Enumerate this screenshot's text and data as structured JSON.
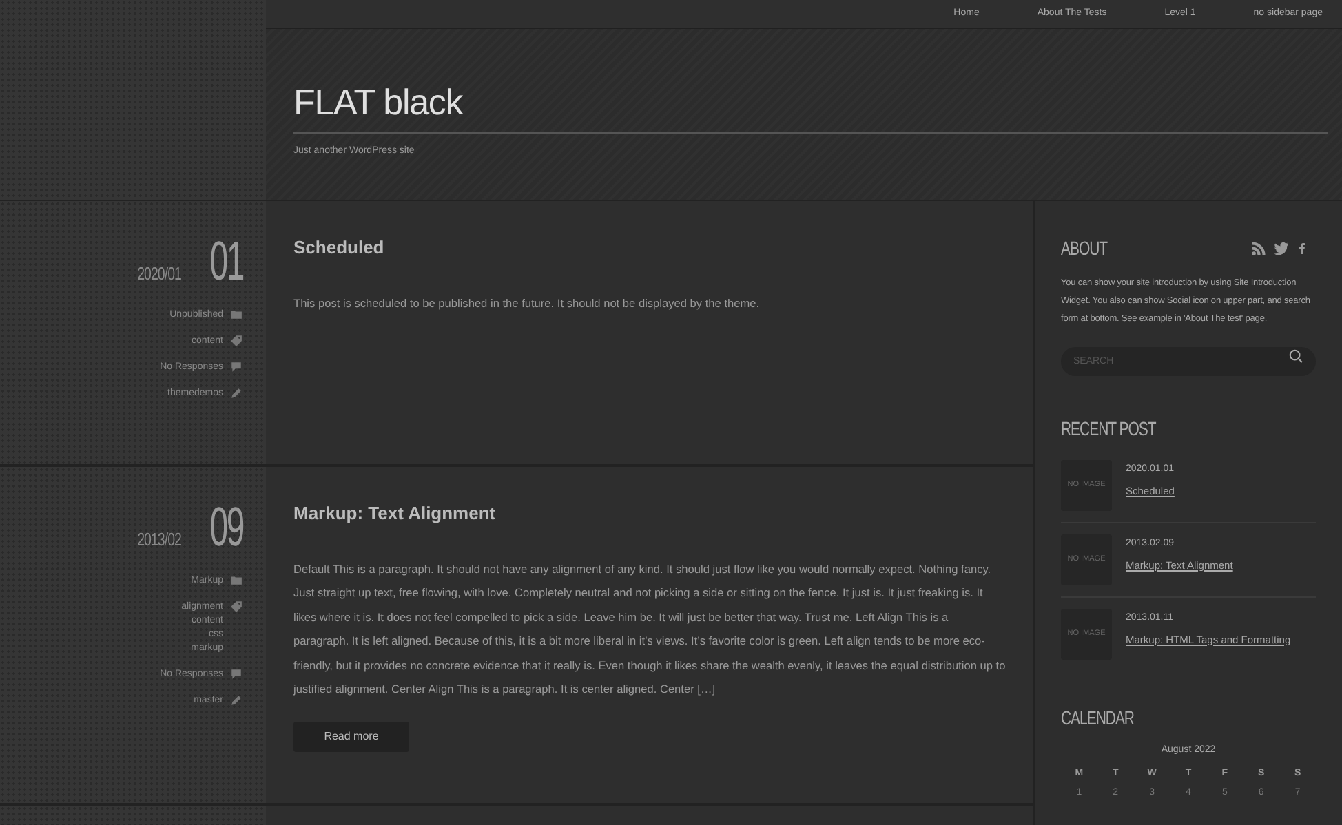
{
  "nav": [
    {
      "label": "Home"
    },
    {
      "label": "About The Tests"
    },
    {
      "label": "Level 1"
    },
    {
      "label": "no sidebar page"
    }
  ],
  "site": {
    "title": "FLAT black",
    "tagline": "Just another WordPress site"
  },
  "posts": [
    {
      "date_ym": "2020/01",
      "date_d": "01",
      "title": "Scheduled",
      "excerpt": "This post is scheduled to be published in the future. It should not be displayed by the theme.",
      "meta": [
        {
          "kind": "category",
          "texts": [
            "Unpublished"
          ]
        },
        {
          "kind": "tags",
          "texts": [
            "content"
          ]
        },
        {
          "kind": "comments",
          "texts": [
            "No Responses"
          ]
        },
        {
          "kind": "author",
          "texts": [
            "themedemos"
          ]
        }
      ]
    },
    {
      "date_ym": "2013/02",
      "date_d": "09",
      "title": "Markup: Text Alignment",
      "excerpt": "Default This is a paragraph. It should not have any alignment of any kind. It should just flow like you would normally expect. Nothing fancy. Just straight up text, free flowing, with love. Completely neutral and not picking a side or sitting on the fence. It just is. It just freaking is. It likes where it is. It does not feel compelled to pick a side. Leave him be. It will just be better that way. Trust me. Left Align This is a paragraph. It is left aligned. Because of this, it is a bit more liberal in it’s views. It’s favorite color is green. Left align tends to be more eco-friendly, but it provides no concrete evidence that it really is. Even though it likes share the wealth evenly, it leaves the equal distribution up to justified alignment. Center Align This is a paragraph. It is center aligned. Center […]",
      "read_more": "Read more",
      "meta": [
        {
          "kind": "category",
          "texts": [
            "Markup"
          ]
        },
        {
          "kind": "tags",
          "texts": [
            "alignment",
            "content",
            "css",
            "markup"
          ]
        },
        {
          "kind": "comments",
          "texts": [
            "No Responses"
          ]
        },
        {
          "kind": "author",
          "texts": [
            "master"
          ]
        }
      ]
    }
  ],
  "sidebar": {
    "about": {
      "title": "ABOUT",
      "text": "You can show your site introduction by using Site Introduction Widget. You also can show Social icon on upper part, and search form at bottom. See example in 'About The test' page.",
      "search_placeholder": "SEARCH"
    },
    "recent": {
      "title": "RECENT POST",
      "items": [
        {
          "thumb": "NO IMAGE",
          "date": "2020.01.01",
          "title": "Scheduled"
        },
        {
          "thumb": "NO IMAGE",
          "date": "2013.02.09",
          "title": "Markup: Text Alignment"
        },
        {
          "thumb": "NO IMAGE",
          "date": "2013.01.11",
          "title": "Markup: HTML Tags and Formatting"
        }
      ]
    },
    "calendar": {
      "title": "CALENDAR",
      "month": "August 2022",
      "weekdays": [
        "M",
        "T",
        "W",
        "T",
        "F",
        "S",
        "S"
      ],
      "days": [
        "1",
        "2",
        "3",
        "4",
        "5",
        "6",
        "7"
      ]
    }
  }
}
